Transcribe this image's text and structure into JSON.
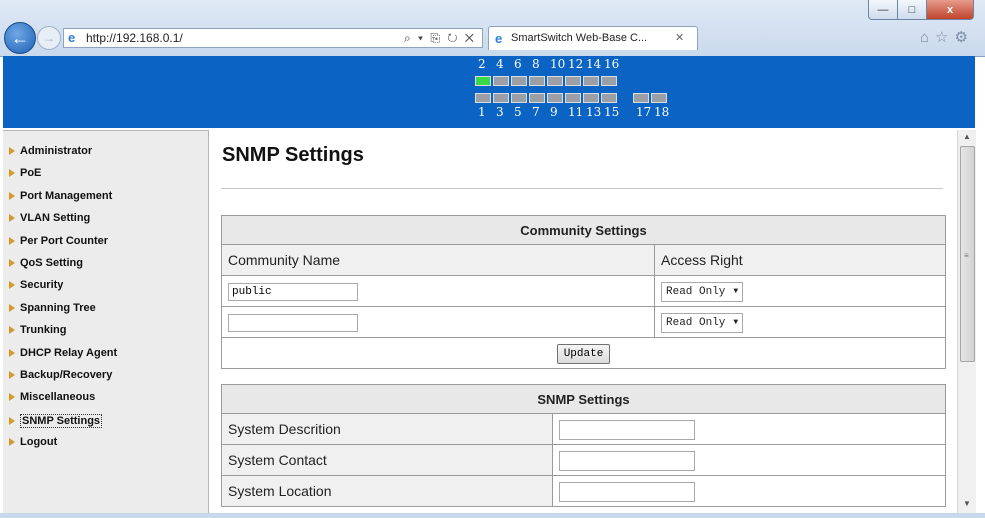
{
  "browser": {
    "url": "http://192.168.0.1/",
    "tab_title": "SmartSwitch Web-Base C...",
    "window_min": "—",
    "window_max": "□",
    "window_close": "x",
    "addr_tools": "⌕ ▾ ⎘ ↻ ✕",
    "tab_close": "✕",
    "right_icons": "⌂☆⚙"
  },
  "ports": {
    "top_labels": [
      "2",
      "4",
      "6",
      "8",
      "10",
      "12",
      "14",
      "16"
    ],
    "bottom_labels": [
      "1",
      "3",
      "5",
      "7",
      "9",
      "11",
      "13",
      "15",
      "17",
      "18"
    ],
    "active_port": "2",
    "active_color": "#39d84a",
    "inactive_color": "#9aa0a6"
  },
  "sidebar": {
    "items": [
      {
        "label": "Administrator"
      },
      {
        "label": "PoE"
      },
      {
        "label": "Port Management"
      },
      {
        "label": "VLAN Setting"
      },
      {
        "label": "Per Port Counter"
      },
      {
        "label": "QoS Setting"
      },
      {
        "label": "Security"
      },
      {
        "label": "Spanning Tree"
      },
      {
        "label": "Trunking"
      },
      {
        "label": "DHCP Relay Agent"
      },
      {
        "label": "Backup/Recovery"
      },
      {
        "label": "Miscellaneous"
      },
      {
        "label": "SNMP Settings"
      },
      {
        "label": "Logout"
      }
    ],
    "selected": "SNMP Settings"
  },
  "main": {
    "title": "SNMP Settings",
    "community": {
      "caption": "Community Settings",
      "col_name": "Community Name",
      "col_access": "Access Right",
      "rows": [
        {
          "name": "public",
          "access": "Read Only"
        },
        {
          "name": "",
          "access": "Read Only"
        }
      ],
      "update_label": "Update"
    },
    "snmp": {
      "caption": "SNMP Settings",
      "rows": [
        {
          "label": "System Descrition",
          "value": ""
        },
        {
          "label": "System Contact",
          "value": ""
        },
        {
          "label": "System Location",
          "value": ""
        }
      ]
    }
  },
  "colors": {
    "banner": "#0b63c4",
    "sidebar_bg": "#ececec",
    "arrow": "#d39a2a"
  }
}
